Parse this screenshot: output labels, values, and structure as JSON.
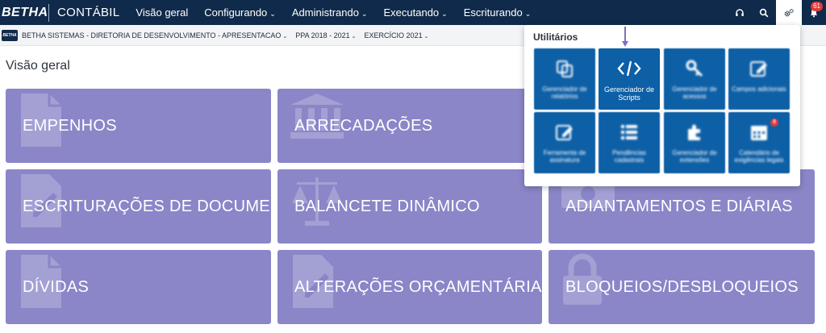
{
  "topbar": {
    "brand": "BETHA",
    "app_name": "CONTÁBIL",
    "nav": [
      {
        "label": "Visão geral",
        "has_menu": false
      },
      {
        "label": "Configurando",
        "has_menu": true
      },
      {
        "label": "Administrando",
        "has_menu": true
      },
      {
        "label": "Executando",
        "has_menu": true
      },
      {
        "label": "Escriturando",
        "has_menu": true
      }
    ],
    "icons": [
      "headset-icon",
      "search-icon",
      "gears-icon",
      "bell-icon"
    ],
    "notification_count": "61"
  },
  "context": {
    "logo_text": "BETHA",
    "entity": "BETHA SISTEMAS - DIRETORIA DE DESENVOLVIMENTO - APRESENTACAO",
    "ppa": "PPA 2018 - 2021",
    "exercise": "EXERCÍCIO 2021"
  },
  "page": {
    "title": "Visão geral"
  },
  "cards": [
    {
      "label": "EMPENHOS",
      "icon": "document-icon"
    },
    {
      "label": "ARRECADAÇÕES",
      "icon": "bank-icon"
    },
    {
      "label": "ESCRITURAÇÕES DE DOCUME...",
      "icon": "document-edit-icon"
    },
    {
      "label": "BALANCETE DINÂMICO",
      "icon": "scale-icon"
    },
    {
      "label": "ADIANTAMENTOS E DIÁRIAS",
      "icon": "money-icon"
    },
    {
      "label": "DÍVIDAS",
      "icon": "document-icon"
    },
    {
      "label": "ALTERAÇÕES ORÇAMENTÁRIA...",
      "icon": "document-edit-icon"
    },
    {
      "label": "BLOQUEIOS/DESBLOQUEIOS",
      "icon": "lock-icon"
    }
  ],
  "utilities": {
    "title": "Utilitários",
    "tiles": [
      {
        "label": "Gerenciador de relatórios",
        "icon": "reports-icon"
      },
      {
        "label": "Gerenciador de Scripts",
        "icon": "code-icon"
      },
      {
        "label": "Gerenciador de acessos",
        "icon": "key-icon"
      },
      {
        "label": "Campos adicionais",
        "icon": "edit-icon"
      },
      {
        "label": "Ferramenta de assinatura",
        "icon": "edit-icon"
      },
      {
        "label": "Pendências cadastrais",
        "icon": "list-icon"
      },
      {
        "label": "Gerenciador de extensões",
        "icon": "puzzle-icon"
      },
      {
        "label": "Calendário de exigências legais",
        "icon": "calendar-icon",
        "badge": "8"
      }
    ]
  },
  "colors": {
    "topbar": "#0f2a4a",
    "card": "#8a86c8",
    "tile": "#0d5fa6",
    "badge": "#e03b3b"
  }
}
